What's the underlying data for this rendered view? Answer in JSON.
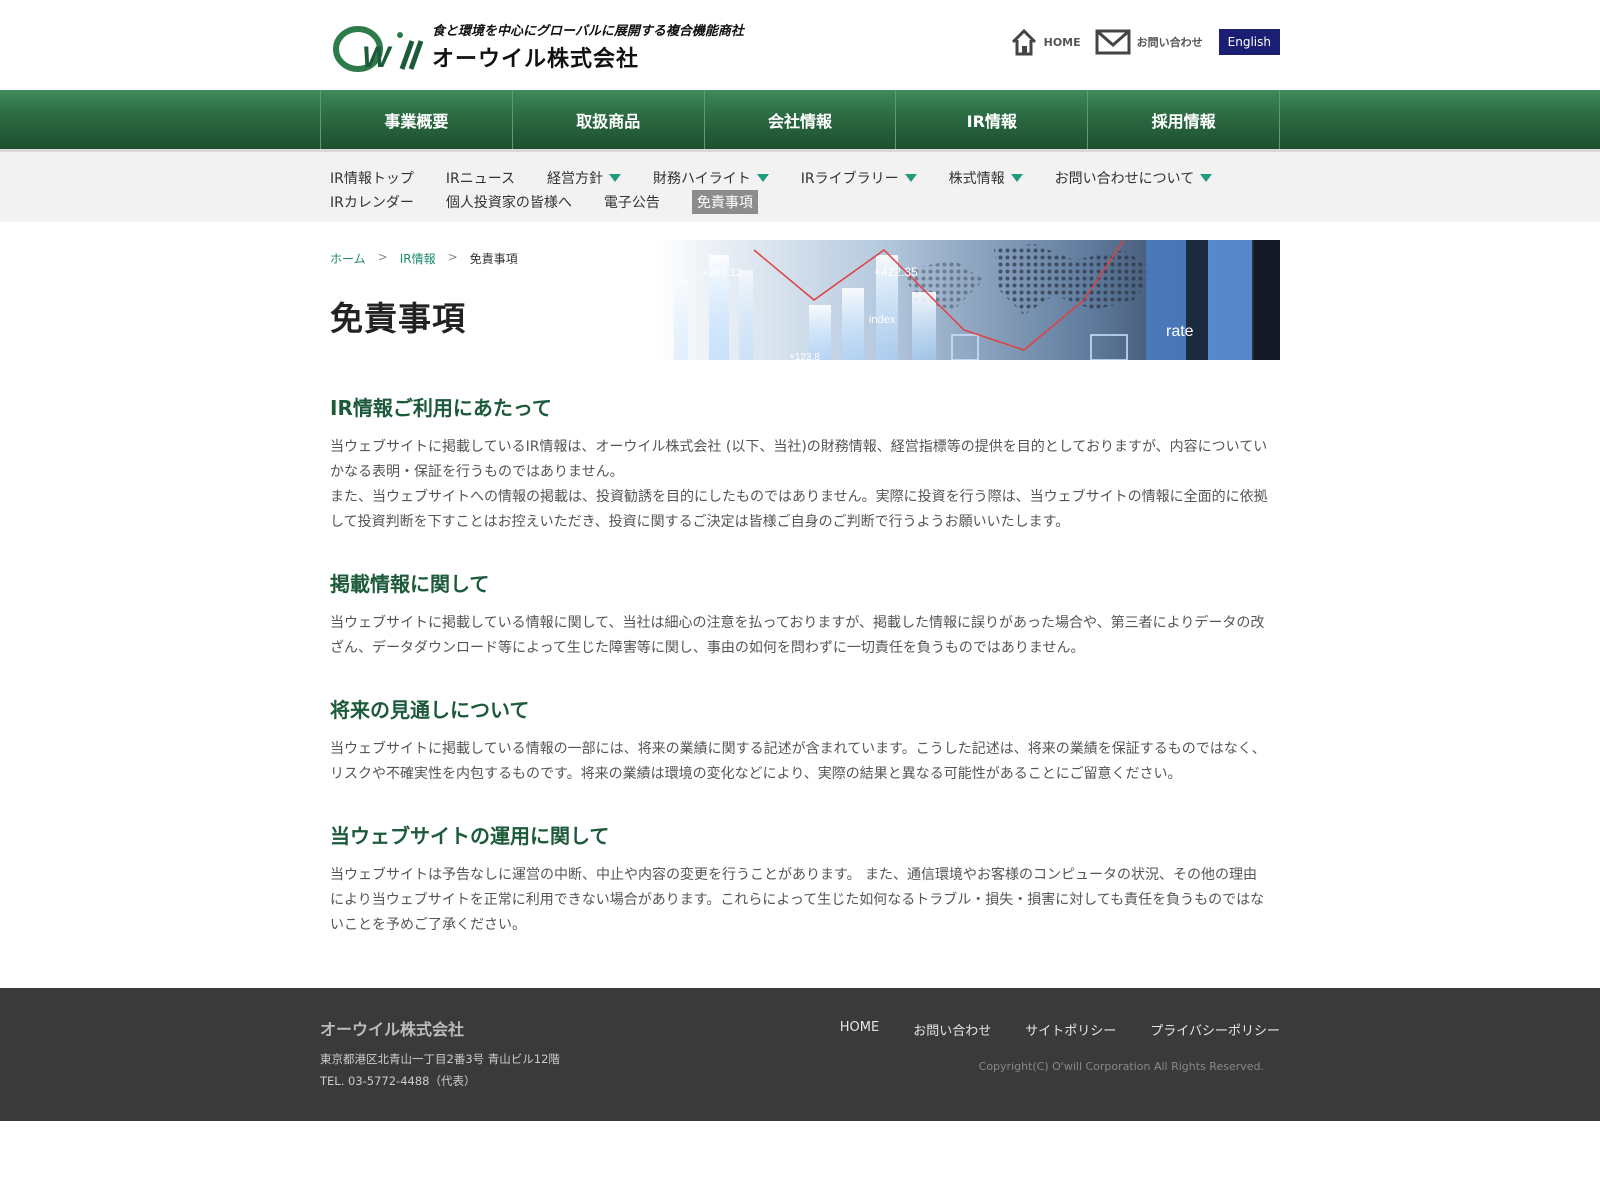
{
  "header": {
    "tagline": "食と環境を中心にグローバルに展開する複合機能商社",
    "company_name": "オーウイル株式会社",
    "logo_icon": "owill-logo-icon",
    "home_label": "HOME",
    "contact_label": "お問い合わせ",
    "lang_label": "English"
  },
  "global_nav": {
    "items": [
      {
        "label": "事業概要"
      },
      {
        "label": "取扱商品"
      },
      {
        "label": "会社情報"
      },
      {
        "label": "IR情報"
      },
      {
        "label": "採用情報"
      }
    ]
  },
  "sub_nav": {
    "row1": [
      {
        "label": "IR情報トップ"
      },
      {
        "label": "IRニュース"
      },
      {
        "label": "経営方針"
      },
      {
        "label": "財務ハイライト"
      },
      {
        "label": "IRライブラリー"
      },
      {
        "label": "株式情報"
      },
      {
        "label": "お問い合わせについて"
      }
    ],
    "row2": [
      {
        "label": "IRカレンダー"
      },
      {
        "label": "個人投資家の皆様へ"
      },
      {
        "label": "電子公告"
      },
      {
        "label": "免責事項"
      }
    ]
  },
  "breadcrumb": {
    "home": "ホーム",
    "ir": "IR情報",
    "current": "免責事項",
    "sep": ">"
  },
  "page_title": "免責事項",
  "banner": {
    "labels": [
      "+263.12",
      "+422.35",
      "index",
      "rate",
      "+123.8"
    ]
  },
  "sections": [
    {
      "heading": "IR情報ご利用にあたって",
      "paragraphs": [
        "当ウェブサイトに掲載しているIR情報は、オーウイル株式会社 (以下、当社)の財務情報、経営指標等の提供を目的としておりますが、内容についていかなる表明・保証を行うものではありません。",
        "また、当ウェブサイトへの情報の掲載は、投資勧誘を目的にしたものではありません。実際に投資を行う際は、当ウェブサイトの情報に全面的に依拠して投資判断を下すことはお控えいただき、投資に関するご決定は皆様ご自身のご判断で行うようお願いいたします。"
      ]
    },
    {
      "heading": "掲載情報に関して",
      "paragraphs": [
        "当ウェブサイトに掲載している情報に関して、当社は細心の注意を払っておりますが、掲載した情報に誤りがあった場合や、第三者によりデータの改ざん、データダウンロード等によって生じた障害等に関し、事由の如何を問わずに一切責任を負うものではありません。"
      ]
    },
    {
      "heading": "将来の見通しについて",
      "paragraphs": [
        "当ウェブサイトに掲載している情報の一部には、将来の業績に関する記述が含まれています。こうした記述は、将来の業績を保証するものではなく、リスクや不確実性を内包するものです。将来の業績は環境の変化などにより、実際の結果と異なる可能性があることにご留意ください。"
      ]
    },
    {
      "heading": "当ウェブサイトの運用に関して",
      "paragraphs": [
        "当ウェブサイトは予告なしに運営の中断、中止や内容の変更を行うことがあります。 また、通信環境やお客様のコンピュータの状況、その他の理由により当ウェブサイトを正常に利用できない場合があります。これらによって生じた如何なるトラブル・損失・損害に対しても責任を負うものではないことを予めご了承ください。"
      ]
    }
  ],
  "footer": {
    "company": "オーウイル株式会社",
    "address": "東京都港区北青山一丁目2番3号 青山ビル12階",
    "tel": "TEL. 03-5772-4488（代表）",
    "links": [
      "HOME",
      "お問い合わせ",
      "サイトポリシー",
      "プライバシーポリシー"
    ],
    "copyright": "Copyright(C) O'will Corporation All Rights Reserved."
  },
  "colors": {
    "nav_green": "#2b6a42",
    "heading_green": "#1d5a3a",
    "link_green": "#1a8a6a",
    "lang_navy": "#1a1f73",
    "footer_bg": "#3a3a3a"
  }
}
